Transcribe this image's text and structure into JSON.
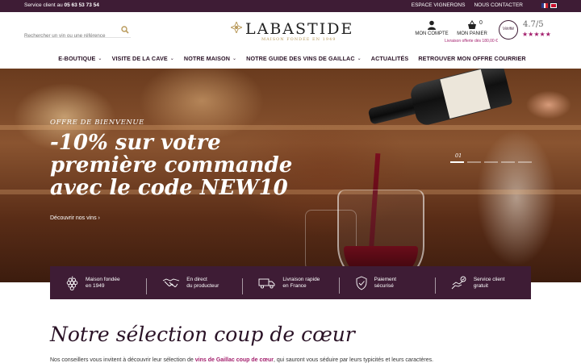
{
  "topbar": {
    "service_label": "Service client au ",
    "service_phone": "05 63 53 73 54",
    "links": [
      "ESPACE VIGNERONS",
      "NOUS CONTACTER"
    ],
    "languages": [
      "fr-flag-icon",
      "en-flag-icon"
    ]
  },
  "header": {
    "search_placeholder": "Rechercher un vin ou une référence",
    "logo_name": "LABASTIDE",
    "logo_tagline": "MAISON FONDÉE EN 1949",
    "account_label": "MON COMPTE",
    "cart_label": "MON PANIER",
    "cart_count": "0",
    "shipping_note": "Livraison offerte dès 180,00 €",
    "rating_badge": "Vérifié",
    "rating_score": "4.7/5",
    "rating_stars": "★★★★★"
  },
  "nav": {
    "items": [
      {
        "label": "E-BOUTIQUE",
        "dropdown": true
      },
      {
        "label": "VISITE DE LA CAVE",
        "dropdown": true
      },
      {
        "label": "NOTRE MAISON",
        "dropdown": true
      },
      {
        "label": "NOTRE GUIDE DES VINS DE GAILLAC",
        "dropdown": true
      },
      {
        "label": "ACTUALITÉS",
        "dropdown": false
      },
      {
        "label": "RETROUVER MON OFFRE COURRIER",
        "dropdown": false
      }
    ]
  },
  "hero": {
    "eyebrow": "OFFRE DE BIENVENUE",
    "headline": "-10% sur votre première commande avec le code NEW10",
    "cta": "Découvrir nos vins ›",
    "slide_number": "01",
    "slide_count": 5,
    "active_slide": 1
  },
  "features": [
    {
      "icon": "grapes-icon",
      "text": "Maison fondée\nen 1949"
    },
    {
      "icon": "handshake-icon",
      "text": "En direct\ndu producteur"
    },
    {
      "icon": "delivery-truck-icon",
      "text": "Livraison rapide\nen France"
    },
    {
      "icon": "secure-shield-icon",
      "text": "Paiement\nsécurisé"
    },
    {
      "icon": "customer-service-icon",
      "text": "Service client\ngratuit"
    }
  ],
  "section": {
    "title": "Notre sélection coup de cœur",
    "intro_start": "Nos conseillers vous invitent à découvrir leur sélection de ",
    "intro_link": "vins de Gaillac coup de cœur",
    "intro_end": ", qui sauront vous séduire par leurs typicités et leurs caractères."
  },
  "colors": {
    "brand_plum": "#3e1c35",
    "accent_magenta": "#a31f6d",
    "logo_gold": "#b99a5b"
  }
}
